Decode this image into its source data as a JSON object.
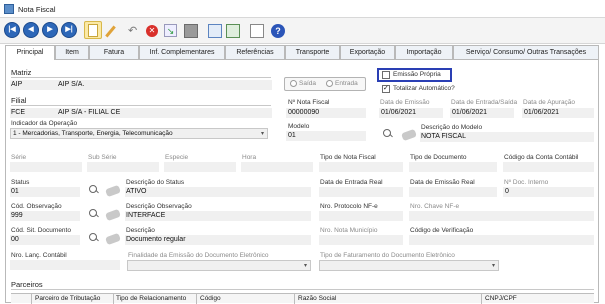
{
  "window": {
    "title": "Nota Fiscal"
  },
  "toolbar": {
    "nav": [
      "first-icon",
      "previous-icon",
      "play-icon",
      "next-icon",
      "last-icon"
    ],
    "actions": [
      "new-icon",
      "edit-icon",
      "undo-icon",
      "delete-icon",
      "confirm-icon",
      "save-icon",
      "report-icon",
      "export-icon",
      "print-icon",
      "help-icon"
    ]
  },
  "tabs": [
    "Principal",
    "Item",
    "Fatura",
    "Inf. Complementares",
    "Referências",
    "Transporte",
    "Exportação",
    "Importação",
    "Serviço/ Consumo/ Outras Transações"
  ],
  "form": {
    "matriz": {
      "label": "Matriz",
      "code": "AIP",
      "name": "AIP S/A."
    },
    "tipo_radio": {
      "saida": "Saída",
      "entrada": "Entrada"
    },
    "emissao_propria": "Emissão Própria",
    "totalizar": "Totalizar Automático?",
    "filial": {
      "label": "Filial",
      "code": "FCE",
      "name": "AIP S/A - FILIAL CE"
    },
    "nro_nf": {
      "label": "Nº Nota Fiscal",
      "value": "00000090"
    },
    "data_emissao": {
      "label": "Data de Emissão",
      "value": "01/06/2021"
    },
    "data_entrada_saida": {
      "label": "Data de Entrada/Saída",
      "value": "01/06/2021"
    },
    "data_apuracao": {
      "label": "Data de Apuração",
      "value": "01/06/2021"
    },
    "indicador": {
      "label": "Indicador da Operação",
      "value": "1 - Mercadorias, Transporte, Energia, Teleco​municação"
    },
    "modelo": {
      "label": "Modelo",
      "value": "01"
    },
    "desc_modelo": {
      "label": "Descrição do Modelo",
      "value": "NOTA FISCAL"
    },
    "serie": "Série",
    "sub_serie": "Sub Série",
    "especie": "Especie",
    "hora": "Hora",
    "tipo_nf": "Tipo de Nota Fiscal",
    "tipo_doc": "Tipo de Documento",
    "cod_conta": "Código da Conta Contábil",
    "status": {
      "label": "Status",
      "value": "01"
    },
    "desc_status": {
      "label": "Descrição do Status",
      "value": "ATIVO"
    },
    "data_entrada_real": "Data de Entrada Real",
    "data_emissao_real": "Data de Emissão Real",
    "nro_controle": {
      "label": "Nº Doc. Interno",
      "value": "0"
    },
    "cod_obs": {
      "label": "Cód. Observação",
      "value": "999"
    },
    "desc_obs": {
      "label": "Descrição Observação",
      "value": "INTERFACE"
    },
    "protocolo": "Nro. Protocolo NF-e",
    "chave": "Nro. Chave NF-e",
    "cod_sit": {
      "label": "Cód. Sit. Documento",
      "value": "00"
    },
    "descricao": {
      "label": "Descrição",
      "value": "Documento regular"
    },
    "nro_municipio": "Nro. Nota Município",
    "cod_verif": "Código de Verificação",
    "nro_lanc": "Nro. Lanç. Contábil",
    "finalidade": "Finalidade da Emissão do Documento Eletrônico",
    "tipo_fat": "Tipo de Faturamento do Documento Eletrônico"
  },
  "parceiros": {
    "title": "Parceiros",
    "columns": [
      "Parceiro de Tributação",
      "Tipo de Relacionamento",
      "Código",
      "Razão Social",
      "CNPJ/CPF"
    ]
  }
}
